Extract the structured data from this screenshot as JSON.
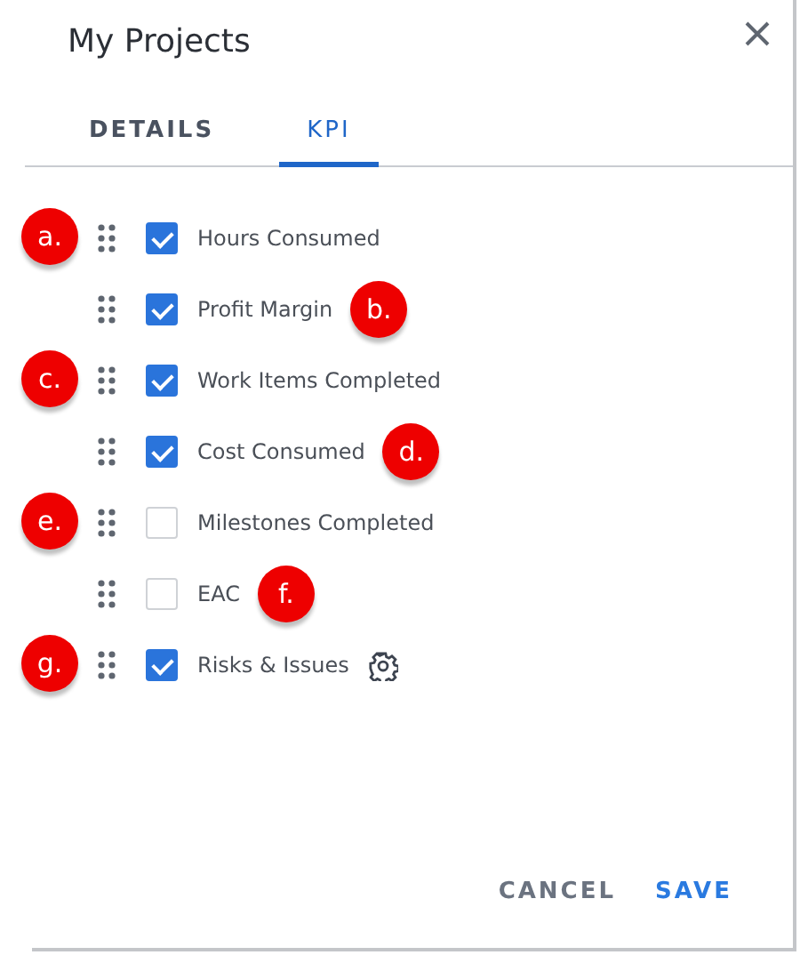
{
  "dialog": {
    "title": "My Projects"
  },
  "tabs": [
    {
      "label": "DETAILS",
      "selected": false
    },
    {
      "label": "KPI",
      "selected": true
    }
  ],
  "kpis": [
    {
      "label": "Hours Consumed",
      "checked": true,
      "marker": {
        "text": "a.",
        "kind": "left"
      }
    },
    {
      "label": "Profit Margin",
      "checked": true,
      "marker": {
        "text": "b.",
        "kind": "right"
      }
    },
    {
      "label": "Work Items Completed",
      "checked": true,
      "marker": {
        "text": "c.",
        "kind": "left"
      }
    },
    {
      "label": "Cost Consumed",
      "checked": true,
      "marker": {
        "text": "d.",
        "kind": "right"
      }
    },
    {
      "label": "Milestones Completed",
      "checked": false,
      "marker": {
        "text": "e.",
        "kind": "left"
      }
    },
    {
      "label": "EAC",
      "checked": false,
      "marker": {
        "text": "f.",
        "kind": "right"
      }
    },
    {
      "label": "Risks & Issues",
      "checked": true,
      "settings": true,
      "marker": {
        "text": "g.",
        "kind": "left"
      }
    }
  ],
  "buttons": [
    {
      "label": "CANCEL",
      "kind": "secondary"
    },
    {
      "label": "SAVE",
      "kind": "primary"
    }
  ]
}
